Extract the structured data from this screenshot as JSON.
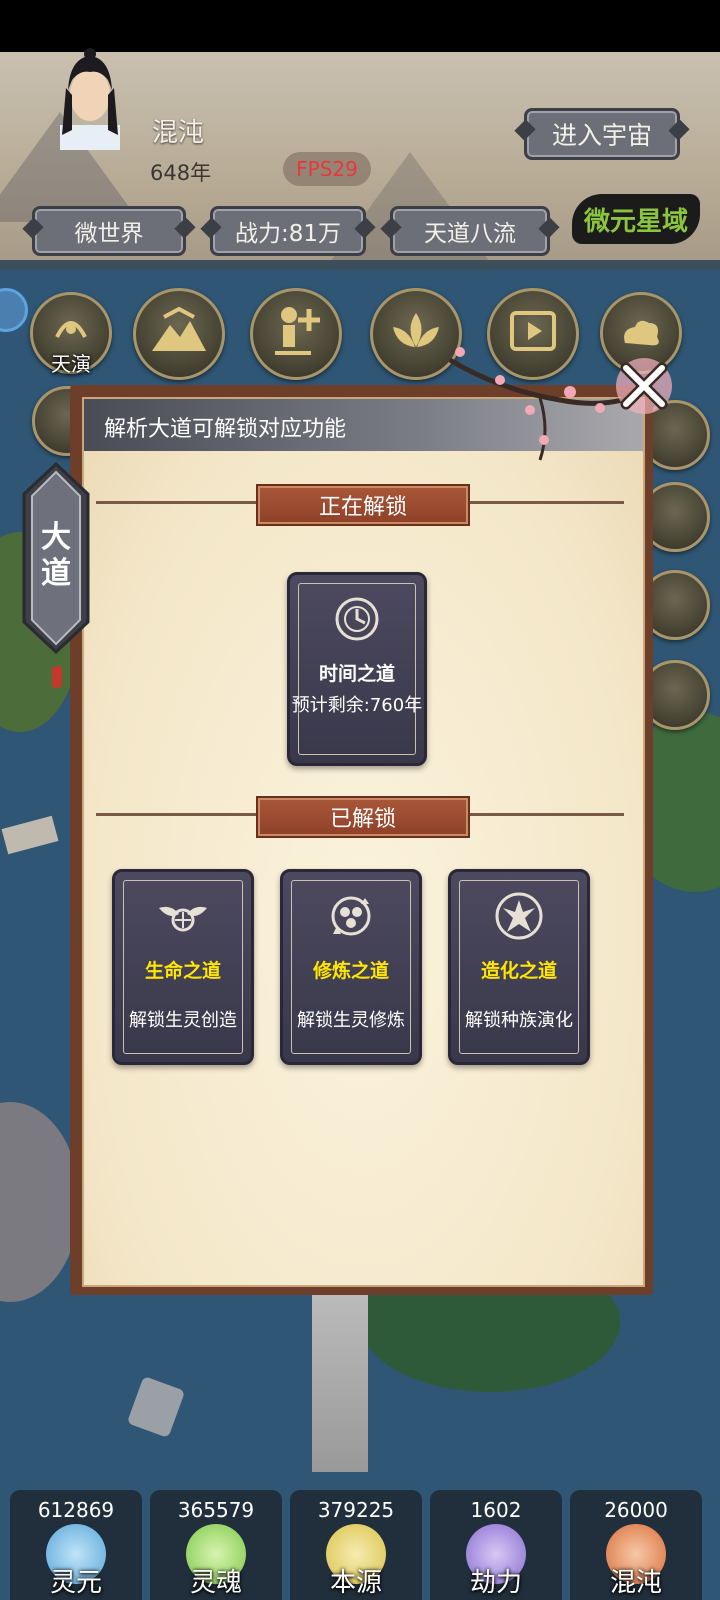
{
  "player": {
    "name": "混沌",
    "age": "648年"
  },
  "header": {
    "enter_universe": "进入宇宙",
    "fps": "FPS29",
    "micro_world": "微世界",
    "power": "战力:81万",
    "tiandao": "天道八流",
    "realm": "微元星域"
  },
  "top_menu": {
    "tianyan": "天演",
    "c2": "创建福地",
    "c3": "创建生灵",
    "c4": "创建法宝",
    "c5": "资源卫星"
  },
  "side_tab": {
    "label": "大道"
  },
  "dialog": {
    "title": "解析大道可解锁对应功能",
    "unlocking_header": "正在解锁",
    "unlocked_header": "已解锁",
    "unlocking": [
      {
        "name": "时间之道",
        "desc": "预计剩余:760年",
        "icon": "time-swirl-icon"
      }
    ],
    "unlocked": [
      {
        "name": "生命之道",
        "desc": "解锁生灵创造",
        "icon": "winged-life-icon"
      },
      {
        "name": "修炼之道",
        "desc": "解锁生灵修炼",
        "icon": "cultivation-cycle-icon"
      },
      {
        "name": "造化之道",
        "desc": "解锁种族演化",
        "icon": "phoenix-icon"
      }
    ]
  },
  "resources": [
    {
      "value": "612869",
      "name": "灵元",
      "color": "#5aa6d8"
    },
    {
      "value": "365579",
      "name": "灵魂",
      "color": "#7fc84a"
    },
    {
      "value": "379225",
      "name": "本源",
      "color": "#d9c24a"
    },
    {
      "value": "1602",
      "name": "劫力",
      "color": "#8a6fd0"
    },
    {
      "value": "26000",
      "name": "混沌",
      "color": "#d9703a"
    }
  ],
  "colors": {
    "highlight_name": "#ffe600",
    "active_name": "#ffffff",
    "realm_text": "#8bc53f",
    "fps_text": "#e53a3a"
  }
}
